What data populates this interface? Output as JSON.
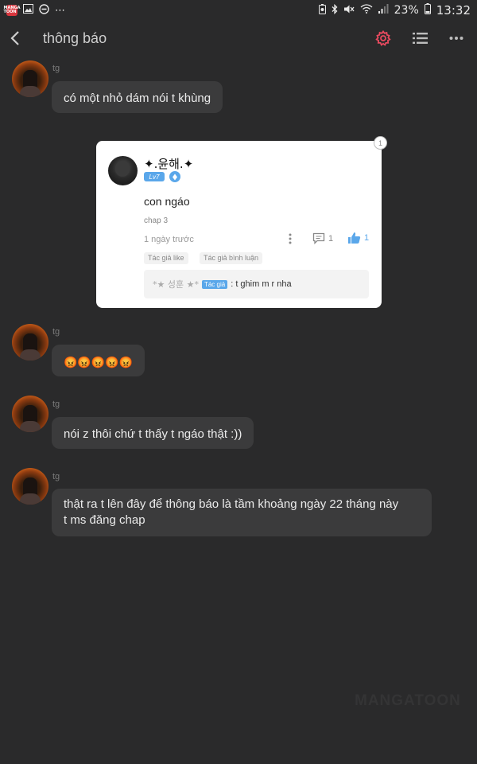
{
  "status_bar": {
    "app_icon_text": "MANGA TOON",
    "battery_percent": "23%",
    "time": "13:32",
    "icons": [
      "image-icon",
      "do-not-disturb-icon",
      "more-dots-icon",
      "battery-saver-icon",
      "bluetooth-icon",
      "mute-icon",
      "wifi-icon",
      "signal-icon",
      "battery-icon"
    ]
  },
  "header": {
    "title": "thông báo",
    "accent_color": "#e84a5f"
  },
  "messages": [
    {
      "sender": "tg",
      "text": "có một nhỏ dám nói t khùng"
    },
    {
      "sender": "tg",
      "text": "😡😡😡😡😡"
    },
    {
      "sender": "tg",
      "text": "nói z thôi chứ t thấy t ngáo thật :))"
    },
    {
      "sender": "tg",
      "text_line1": "thật ra t lên đây để thông báo là tầm khoảng ngày 22 tháng này",
      "text_line2": "t ms đăng chap"
    }
  ],
  "comment_card": {
    "badge_count": "1",
    "username": "✦.윤해.✦",
    "level": "Lv7",
    "comment": "con ngáo",
    "chapter": "chap 3",
    "time": "1 ngày trước",
    "reply_count": "1",
    "like_count": "1",
    "tags": [
      "Tác giả like",
      "Tác giả bình luận"
    ],
    "reply": {
      "name": "*★ 성훈 ★*",
      "author_label": "Tác giả",
      "text": ": t ghim m r nha"
    }
  },
  "watermark": "MANGATOON"
}
